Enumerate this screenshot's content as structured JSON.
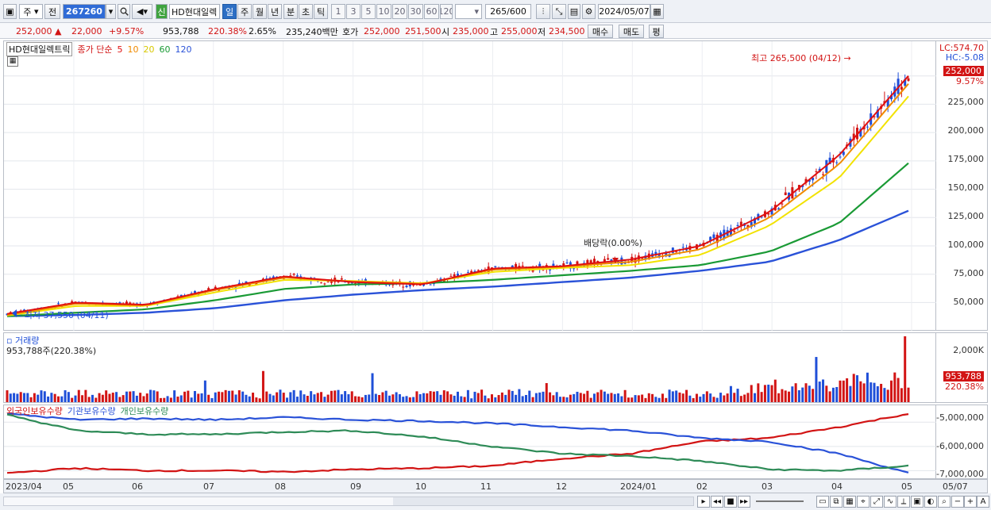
{
  "toolbar": {
    "period_options": [
      "주",
      "전"
    ],
    "code": "267260",
    "market_badge": "신",
    "stock_name": "HD현대일렉",
    "tabs": [
      "일",
      "주",
      "월",
      "년",
      "분",
      "초",
      "틱"
    ],
    "active_tab": "일",
    "intervals": [
      "1",
      "3",
      "5",
      "10",
      "20",
      "30",
      "60",
      "120"
    ],
    "count_value": "265",
    "count_total": "/600",
    "date": "2024/05/07"
  },
  "quote": {
    "price": "252,000",
    "direction": "▲",
    "change": "22,000",
    "change_pct": "+9.57%",
    "volume": "953,788",
    "volume_ratio": "220.38%",
    "turnover_pct": "2.65%",
    "amount": "235,240백만",
    "ask_label": "호가",
    "ask": "252,000",
    "bid": "251,500",
    "open_label": "시",
    "open": "235,000",
    "high_label": "고",
    "high": "255,000",
    "low_label": "저",
    "low": "234,500",
    "buy_label": "매수",
    "sell_label": "매도",
    "eval_label": "평"
  },
  "price_panel": {
    "title": "HD현대일렉트릭",
    "ma_label": "종가 단순",
    "ma_periods": [
      "5",
      "10",
      "20",
      "60",
      "120"
    ],
    "high_annotation": "최고 265,500 (04/12)",
    "low_annotation": "최저 37,550 (04/11)",
    "dividend_annotation": "배당락(0.00%)",
    "lc_label": "LC:574.70",
    "hc_label": "HC:-5.08",
    "price_tag": "252,000",
    "pct_tag": "9.57%",
    "y_labels": [
      "225,000",
      "200,000",
      "175,000",
      "150,000",
      "125,000",
      "100,000",
      "75,000",
      "50,000"
    ]
  },
  "volume_panel": {
    "title": "거래량",
    "value": "953,788주(220.38%)",
    "y_label": "2,000K",
    "volume_tag": "953,788",
    "pct_tag": "220.38%"
  },
  "holdings_panel": {
    "legend": [
      "외국인보유수량",
      "기관보유수량",
      "개인보유수량"
    ],
    "y_labels": [
      "-5,000,000",
      "-6,000,000",
      "-7,000,000"
    ]
  },
  "x_axis": [
    "2023/04",
    "05",
    "06",
    "07",
    "08",
    "09",
    "10",
    "11",
    "12",
    "2024/01",
    "02",
    "03",
    "04",
    "05",
    "05/07"
  ],
  "colors": {
    "up": "#d21414",
    "down": "#1f4fd8",
    "ma5": "#e01010",
    "ma10": "#f08a00",
    "ma20": "#f2e200",
    "ma60": "#1a9a35",
    "ma120": "#2a52d8",
    "foreign": "#d21414",
    "institution": "#2a52d8",
    "individual": "#2e8b57"
  },
  "chart_data": [
    {
      "type": "line",
      "title": "HD현대일렉트릭",
      "x": [
        "2023/04",
        "05",
        "06",
        "07",
        "08",
        "09",
        "10",
        "11",
        "12",
        "2024/01",
        "02",
        "03",
        "04",
        "05/07"
      ],
      "series": [
        {
          "name": "5",
          "values": [
            40000,
            50000,
            48000,
            62000,
            73000,
            68000,
            66000,
            80000,
            82000,
            88000,
            100000,
            130000,
            180000,
            250000
          ]
        },
        {
          "name": "10",
          "values": [
            39000,
            49000,
            47500,
            61000,
            72000,
            68500,
            66500,
            79000,
            81500,
            86000,
            97000,
            125000,
            172000,
            243000
          ]
        },
        {
          "name": "20",
          "values": [
            38500,
            47000,
            47000,
            59000,
            70000,
            69000,
            67000,
            77000,
            80500,
            83000,
            92000,
            118000,
            160000,
            232000
          ]
        },
        {
          "name": "60",
          "values": [
            38000,
            41000,
            44000,
            52000,
            62000,
            66000,
            67000,
            70000,
            74000,
            78000,
            83000,
            95000,
            120000,
            173000
          ]
        },
        {
          "name": "120",
          "values": [
            38000,
            39000,
            41000,
            45000,
            52000,
            57000,
            61000,
            64000,
            68000,
            72000,
            78000,
            86000,
            105000,
            131000
          ]
        }
      ],
      "ylim": [
        30000,
        275000
      ],
      "grid": true
    },
    {
      "type": "bar",
      "title": "거래량",
      "ylabel": "",
      "ylim": [
        0,
        2500000
      ]
    },
    {
      "type": "line",
      "x": [
        "2023/04",
        "05",
        "06",
        "07",
        "08",
        "09",
        "10",
        "11",
        "12",
        "2024/01",
        "02",
        "03",
        "04",
        "05/07"
      ],
      "series": [
        {
          "name": "외국인보유수량",
          "values": [
            -7100000,
            -6900000,
            -7000000,
            -7000000,
            -7050000,
            -6950000,
            -6900000,
            -6800000,
            -6500000,
            -6300000,
            -5800000,
            -5650000,
            -5200000,
            -4650000
          ]
        },
        {
          "name": "기관보유수량",
          "values": [
            -4650000,
            -4900000,
            -4850000,
            -4900000,
            -4800000,
            -4900000,
            -4950000,
            -5050000,
            -5200000,
            -5350000,
            -5650000,
            -5800000,
            -6300000,
            -7100000
          ]
        },
        {
          "name": "개인보유수량",
          "values": [
            -4700000,
            -5350000,
            -5500000,
            -5500000,
            -5400000,
            -5350000,
            -5600000,
            -6000000,
            -6300000,
            -6400000,
            -6600000,
            -6950000,
            -7000000,
            -6800000
          ]
        }
      ],
      "ylim": [
        -7250000,
        -4500000
      ],
      "grid": true
    }
  ]
}
